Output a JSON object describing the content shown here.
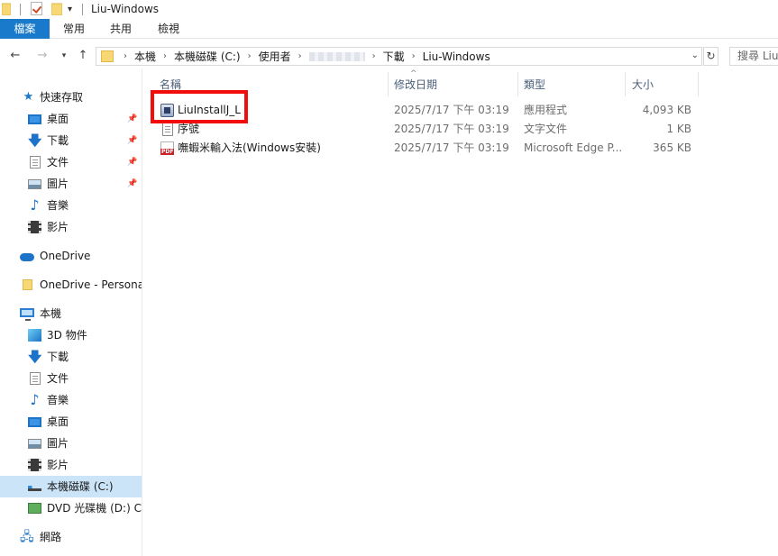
{
  "window": {
    "title": "Liu-Windows"
  },
  "ribbon": {
    "tabs": [
      {
        "label": "檔案",
        "active": true
      },
      {
        "label": "常用"
      },
      {
        "label": "共用"
      },
      {
        "label": "檢視"
      }
    ]
  },
  "address": {
    "crumbs": [
      "本機",
      "本機磁碟 (C:)",
      "使用者",
      "",
      "下載",
      "Liu-Windows"
    ]
  },
  "search": {
    "placeholder": "搜尋 Liu"
  },
  "nav_pane": {
    "items": [
      {
        "label": "快速存取",
        "icon": "star-icon"
      },
      {
        "label": "桌面",
        "icon": "desktop-icon",
        "pinned": true
      },
      {
        "label": "下載",
        "icon": "download-icon",
        "pinned": true
      },
      {
        "label": "文件",
        "icon": "document-icon",
        "pinned": true
      },
      {
        "label": "圖片",
        "icon": "pictures-icon",
        "pinned": true
      },
      {
        "label": "音樂",
        "icon": "music-icon"
      },
      {
        "label": "影片",
        "icon": "videos-icon"
      },
      {
        "label": "OneDrive",
        "icon": "onedrive-icon"
      },
      {
        "label": "OneDrive - Personal",
        "icon": "folder-icon"
      },
      {
        "label": "本機",
        "icon": "this-pc-icon"
      },
      {
        "label": "3D 物件",
        "icon": "3d-objects-icon"
      },
      {
        "label": "下載",
        "icon": "download-icon"
      },
      {
        "label": "文件",
        "icon": "document-icon"
      },
      {
        "label": "音樂",
        "icon": "music-icon"
      },
      {
        "label": "桌面",
        "icon": "desktop-icon"
      },
      {
        "label": "圖片",
        "icon": "pictures-icon"
      },
      {
        "label": "影片",
        "icon": "videos-icon"
      },
      {
        "label": "本機磁碟 (C:)",
        "icon": "drive-icon",
        "selected": true
      },
      {
        "label": "DVD 光碟機 (D:) CP",
        "icon": "dvd-icon"
      },
      {
        "label": "網路",
        "icon": "network-icon"
      }
    ]
  },
  "columns": {
    "name": "名稱",
    "date": "修改日期",
    "type": "類型",
    "size": "大小"
  },
  "files": [
    {
      "name": "LiuInstallJ_L",
      "date": "2025/7/17 下午 03:19",
      "type": "應用程式",
      "size": "4,093 KB",
      "icon": "application-icon"
    },
    {
      "name": "序號",
      "date": "2025/7/17 下午 03:19",
      "type": "文字文件",
      "size": "1 KB",
      "icon": "text-file-icon"
    },
    {
      "name": "嘸蝦米輸入法(Windows安裝)",
      "date": "2025/7/17 下午 03:19",
      "type": "Microsoft Edge P...",
      "size": "365 KB",
      "icon": "pdf-icon"
    }
  ],
  "colors": {
    "accent": "#1979ca",
    "selection": "#cce4f7",
    "highlight_box": "#f20d0d"
  }
}
